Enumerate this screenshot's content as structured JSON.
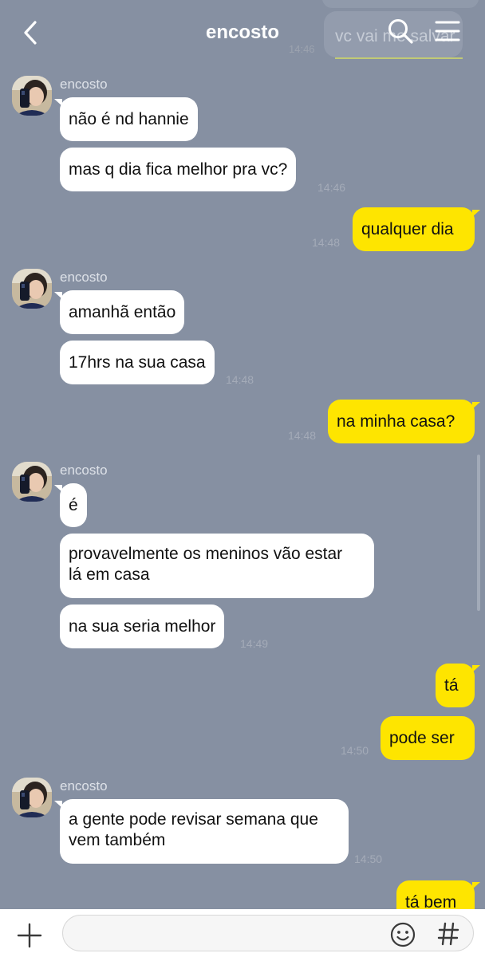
{
  "header": {
    "title": "encosto",
    "ghost_message": "vc vai me salvar",
    "ghost_time": "14:46",
    "icons": [
      "chevron-left-icon",
      "search-icon",
      "menu-icon"
    ]
  },
  "contact": {
    "name": "encosto"
  },
  "messages": [
    {
      "from": "them",
      "text": "não é nd hannie"
    },
    {
      "from": "them",
      "text": "mas q dia fica melhor pra vc?",
      "time": "14:46"
    },
    {
      "from": "me",
      "text": "qualquer dia",
      "time": "14:48"
    },
    {
      "from": "them",
      "text": "amanhã então"
    },
    {
      "from": "them",
      "text": "17hrs na sua casa",
      "time": "14:48"
    },
    {
      "from": "me",
      "text": "na minha casa?",
      "time": "14:48"
    },
    {
      "from": "them",
      "text": "é"
    },
    {
      "from": "them",
      "lines": [
        "provavelmente os meninos vão estar",
        "lá em casa"
      ]
    },
    {
      "from": "them",
      "text": "na sua seria melhor",
      "time": "14:49"
    },
    {
      "from": "me",
      "text": "tá"
    },
    {
      "from": "me",
      "text": "pode ser",
      "time": "14:50"
    },
    {
      "from": "them",
      "lines": [
        "a gente pode revisar semana que",
        "vem também"
      ],
      "time": "14:50"
    },
    {
      "from": "me",
      "text": "tá bem"
    }
  ],
  "colors": {
    "background": "#8690a2",
    "incoming_bubble": "#ffffff",
    "outgoing_bubble": "#fee500"
  },
  "composer": {
    "placeholder": "",
    "icons": [
      "plus-icon",
      "emoji-icon",
      "hashtag-icon"
    ]
  }
}
